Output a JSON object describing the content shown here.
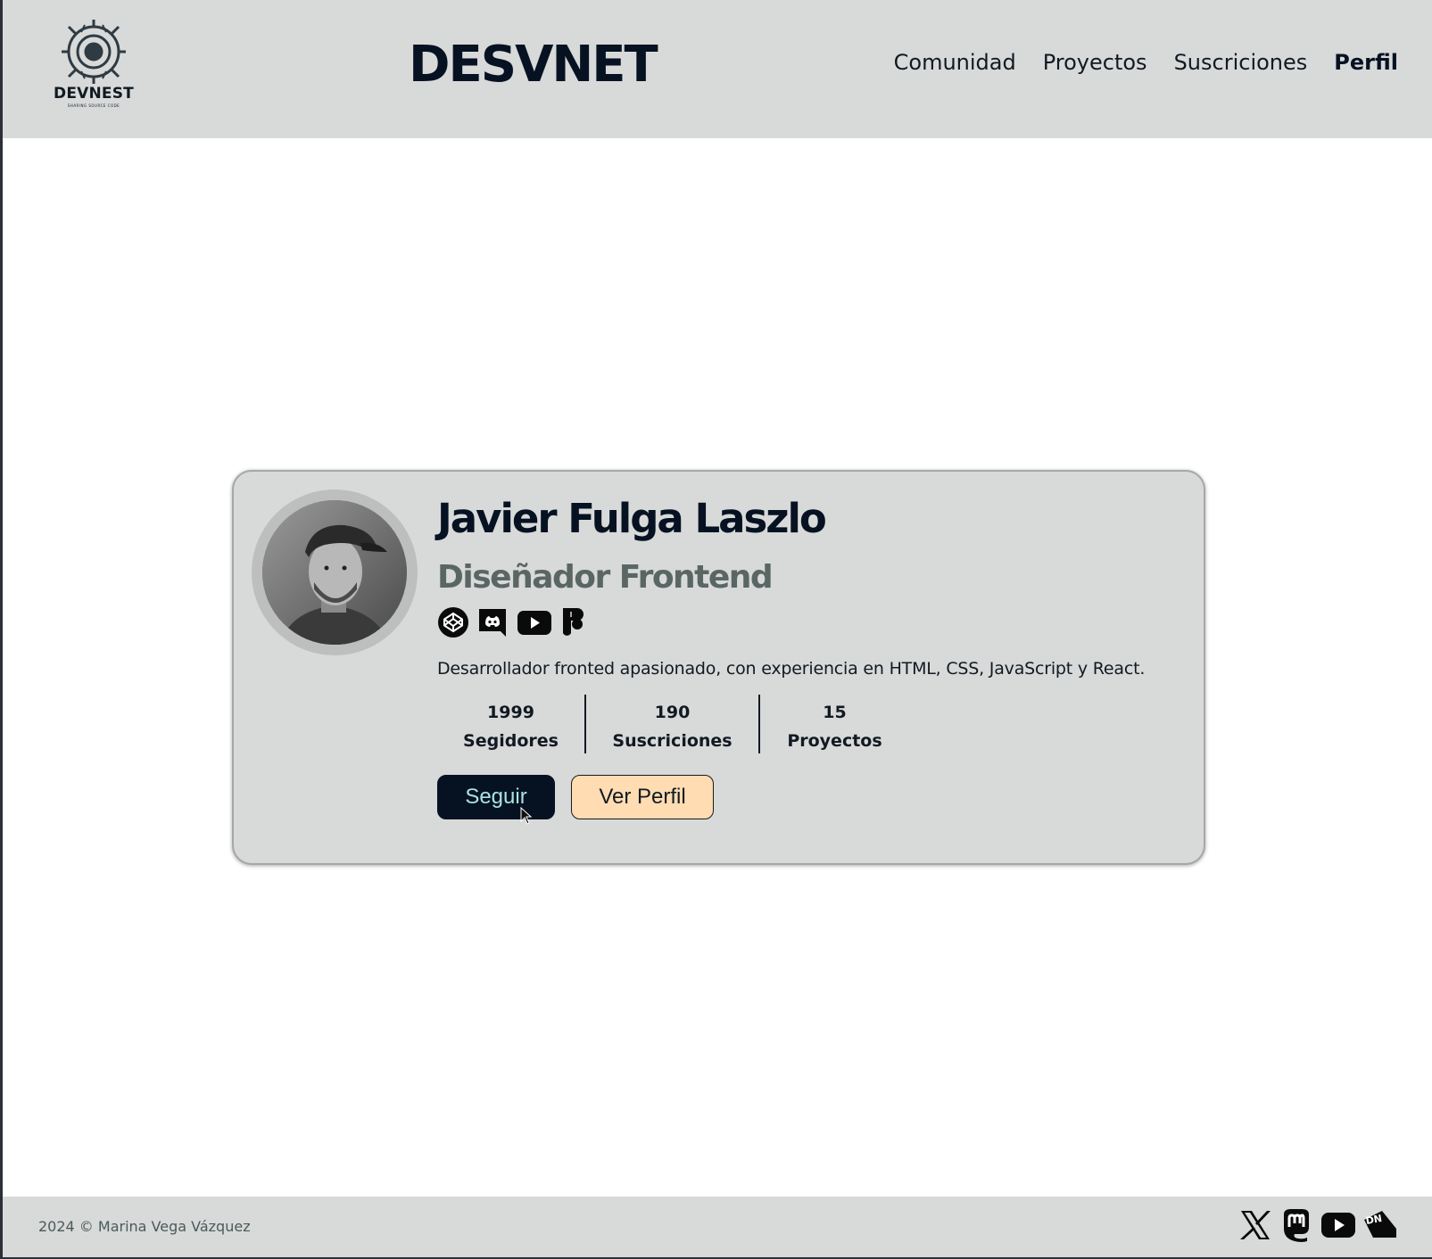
{
  "header": {
    "logo_text": "DEVNEST",
    "logo_tagline": "SHARING SOURCE CODE",
    "brand": "DESVNET",
    "nav": [
      {
        "label": "Comunidad"
      },
      {
        "label": "Proyectos"
      },
      {
        "label": "Suscriciones"
      },
      {
        "label": "Perfil",
        "active": true
      }
    ]
  },
  "profile": {
    "name": "Javier Fulga Laszlo",
    "role": "Diseñador Frontend",
    "socials": [
      "codepen-icon",
      "discord-icon",
      "youtube-icon",
      "figma-icon"
    ],
    "bio": "Desarrollador fronted apasionado, con experiencia en HTML, CSS, JavaScript y React.",
    "stats": [
      {
        "value": "1999",
        "label": "Segidores"
      },
      {
        "value": "190",
        "label": "Suscriciones"
      },
      {
        "value": "15",
        "label": "Proyectos"
      }
    ],
    "follow_label": "Seguir",
    "view_profile_label": "Ver Perfil"
  },
  "footer": {
    "copyright": "2024 © Marina Vega Vázquez",
    "icons": [
      "x-icon",
      "mastodon-icon",
      "youtube-icon",
      "devnest-icon"
    ]
  },
  "colors": {
    "header_bg": "#d8d9d9",
    "brand": "#061222",
    "follow_bg": "#061222",
    "follow_text": "#a9e3df",
    "profile_btn_bg": "#ffdcb2",
    "role_text": "#5a6664"
  }
}
